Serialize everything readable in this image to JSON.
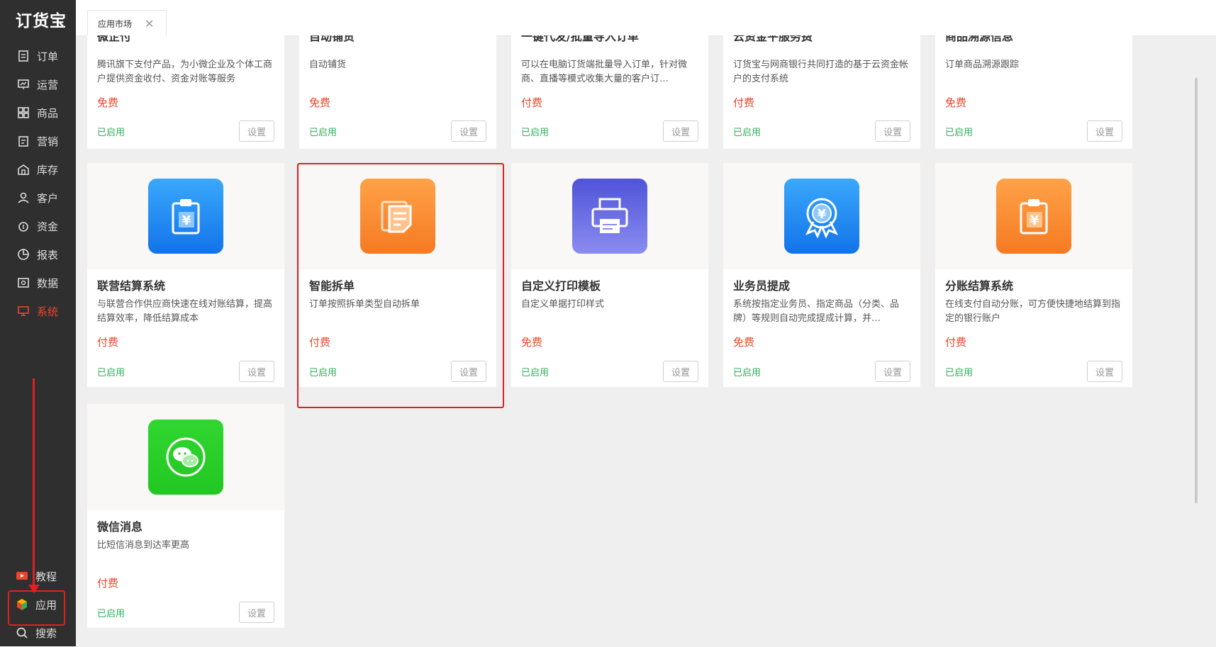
{
  "app": {
    "logo": "订货宝"
  },
  "sidebar": {
    "items": [
      {
        "label": "订单",
        "icon": "order-icon"
      },
      {
        "label": "运营",
        "icon": "operation-icon"
      },
      {
        "label": "商品",
        "icon": "product-icon"
      },
      {
        "label": "营销",
        "icon": "marketing-icon"
      },
      {
        "label": "库存",
        "icon": "inventory-icon"
      },
      {
        "label": "客户",
        "icon": "customer-icon"
      },
      {
        "label": "资金",
        "icon": "funds-icon"
      },
      {
        "label": "报表",
        "icon": "report-icon"
      },
      {
        "label": "数据",
        "icon": "data-icon"
      },
      {
        "label": "系统",
        "icon": "system-icon",
        "active": true
      }
    ],
    "bottom": [
      {
        "label": "教程",
        "icon": "tutorial-icon"
      },
      {
        "label": "应用",
        "icon": "apps-icon"
      },
      {
        "label": "搜索",
        "icon": "search-icon"
      }
    ]
  },
  "tabs": [
    {
      "label": "应用市场"
    }
  ],
  "top_row": [
    {
      "title": "微企付",
      "desc": "腾讯旗下支付产品，为小微企业及个体工商户提供资金收付、资金对账等服务",
      "price": "免费",
      "status": "已启用",
      "btn": "设置"
    },
    {
      "title": "自动铺货",
      "desc": "自动铺货",
      "price": "免费",
      "status": "已启用",
      "btn": "设置"
    },
    {
      "title": "一键代发/批量导入订单",
      "desc": "可以在电脑订货端批量导入订单，针对微商、直播等模式收集大量的客户订…",
      "price": "付费",
      "status": "已启用",
      "btn": "设置"
    },
    {
      "title": "云资金平服务费",
      "desc": "订货宝与网商银行共同打造的基于云资金帐户的支付系统",
      "price": "付费",
      "status": "已启用",
      "btn": "设置"
    },
    {
      "title": "商品溯源信息",
      "desc": "订单商品溯源跟踪",
      "price": "免费",
      "status": "已启用",
      "btn": "设置"
    }
  ],
  "row2": [
    {
      "title": "联营结算系统",
      "desc": "与联营合作供应商快速在线对账结算，提高结算效率，降低结算成本",
      "price": "付费",
      "status": "已启用",
      "btn": "设置",
      "icon": "clipboard-yuan-icon",
      "color": "#1e88f5"
    },
    {
      "title": "智能拆单",
      "desc": "订单按照拆单类型自动拆单",
      "price": "付费",
      "status": "已启用",
      "btn": "设置",
      "icon": "documents-icon",
      "color": "#f98a36"
    },
    {
      "title": "自定义打印模板",
      "desc": "自定义单据打印样式",
      "price": "免费",
      "status": "已启用",
      "btn": "设置",
      "icon": "printer-icon",
      "color": "#6a6ee0"
    },
    {
      "title": "业务员提成",
      "desc": "系统按指定业务员、指定商品（分类、品牌）等规则自动完成提成计算，并…",
      "price": "免费",
      "status": "已启用",
      "btn": "设置",
      "icon": "award-yuan-icon",
      "color": "#1e88f5"
    },
    {
      "title": "分账结算系统",
      "desc": "在线支付自动分账，可方便快捷地结算到指定的银行账户",
      "price": "付费",
      "status": "已启用",
      "btn": "设置",
      "icon": "clipboard-yuan-icon",
      "color": "#f98a36"
    }
  ],
  "row3": [
    {
      "title": "微信消息",
      "desc": "比短信消息到达率更高",
      "price": "付费",
      "status": "已启用",
      "btn": "设置",
      "icon": "wechat-icon",
      "color": "#2bd22b"
    }
  ]
}
